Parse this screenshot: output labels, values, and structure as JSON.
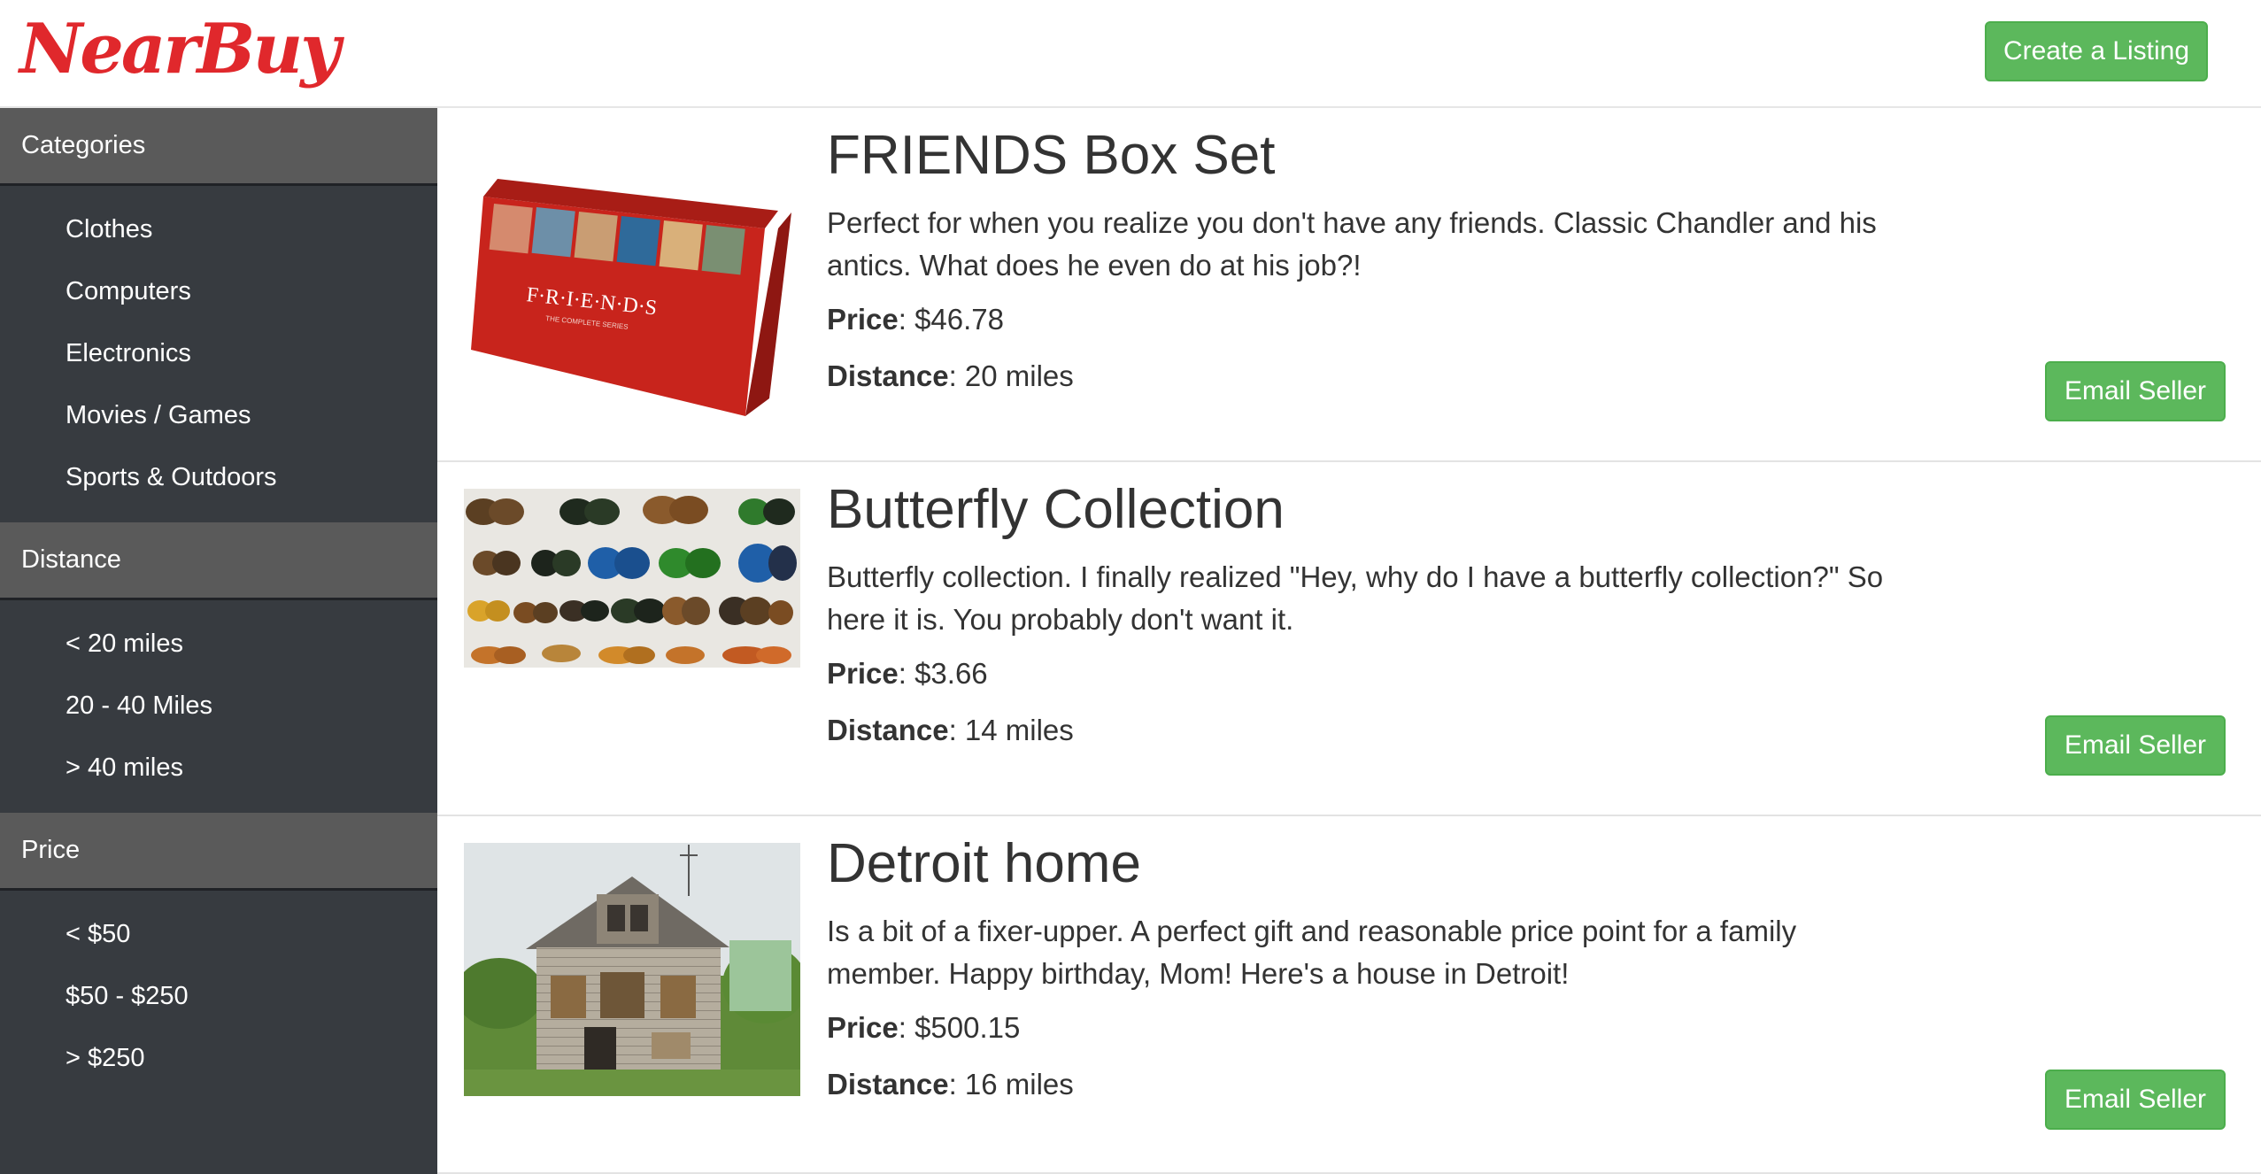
{
  "header": {
    "logo": "NearBuy",
    "create_button": "Create a Listing"
  },
  "sidebar": {
    "sections": [
      {
        "title": "Categories",
        "items": [
          "Clothes",
          "Computers",
          "Electronics",
          "Movies / Games",
          "Sports & Outdoors"
        ]
      },
      {
        "title": "Distance",
        "items": [
          "< 20 miles",
          "20 - 40 Miles",
          "> 40 miles"
        ]
      },
      {
        "title": "Price",
        "items": [
          "< $50",
          "$50 - $250",
          "> $250"
        ]
      }
    ]
  },
  "listing_labels": {
    "price": "Price",
    "distance": "Distance",
    "email_button": "Email Seller"
  },
  "listings": [
    {
      "title": "FRIENDS Box Set",
      "description": "Perfect for when you realize you don't have any friends. Classic Chandler and his antics. What does he even do at his job?!",
      "price": ": $46.78",
      "distance": ": 20 miles",
      "image_text": "F·R·I·E·N·D·S",
      "image_subtext": "THE COMPLETE SERIES"
    },
    {
      "title": "Butterfly Collection",
      "description": "Butterfly collection. I finally realized \"Hey, why do I have a butterfly collection?\" So here it is. You probably don't want it.",
      "price": ": $3.66",
      "distance": ": 14 miles"
    },
    {
      "title": "Detroit home",
      "description": "Is a bit of a fixer-upper. A perfect gift and reasonable price point for a family member. Happy birthday, Mom! Here's a house in Detroit!",
      "price": ": $500.15",
      "distance": ": 16 miles"
    }
  ],
  "colors": {
    "brand": "#e0282c",
    "accent_green": "#5cb85c",
    "sidebar_bg": "#373b40",
    "sidebar_header_bg": "#5a5a5a"
  }
}
